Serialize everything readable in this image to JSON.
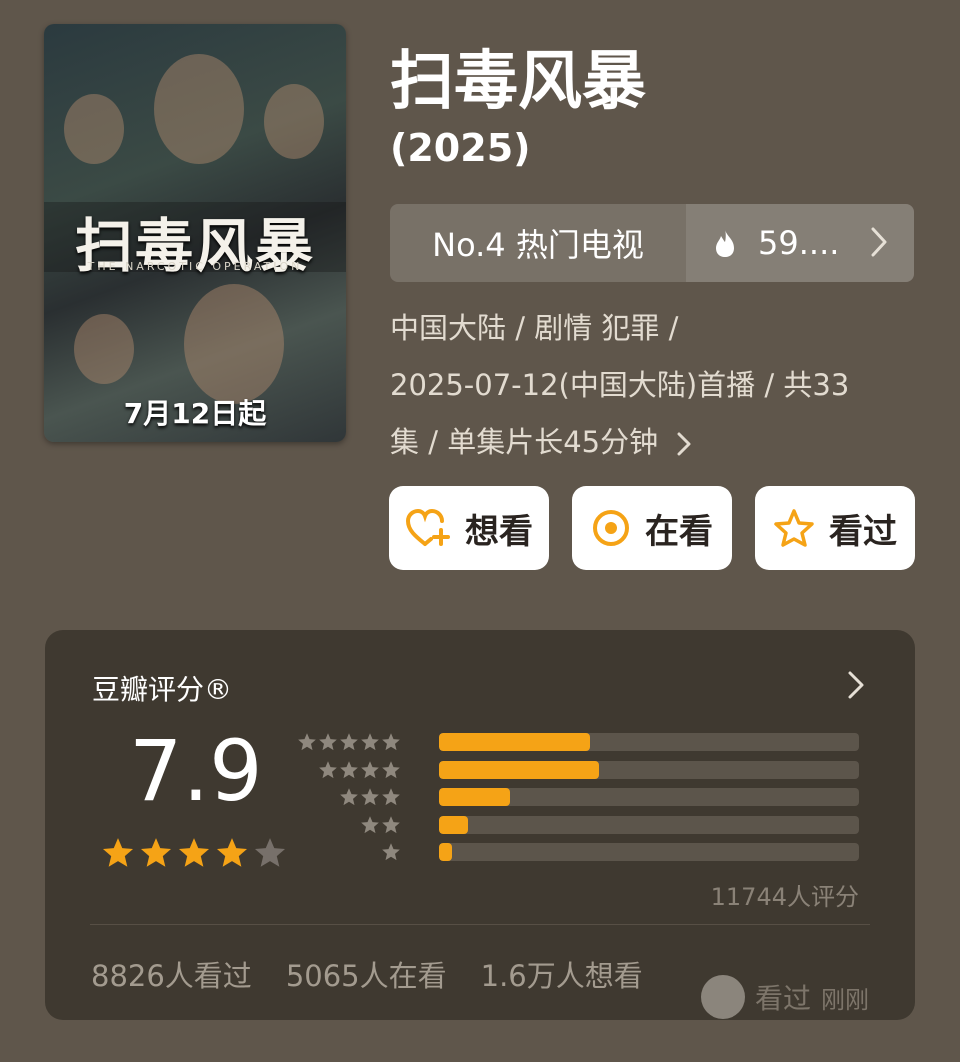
{
  "poster": {
    "title": "扫毒风暴",
    "subtitle": "THE NARCOTIC OPERATION",
    "date": "7月12日起"
  },
  "header": {
    "title": "扫毒风暴",
    "year": "(2025)"
  },
  "ranking": {
    "label": "No.4 热门电视",
    "heat": "59...."
  },
  "meta": {
    "line1": "中国大陆 / 剧情 犯罪 /",
    "line2": "2025-07-12(中国大陆)首播 / 共33",
    "line3": "集 / 单集片长45分钟"
  },
  "actions": {
    "want": "想看",
    "watching": "在看",
    "watched": "看过"
  },
  "rating": {
    "title": "豆瓣评分®",
    "score": "7.9",
    "star_level": 4,
    "distribution": [
      {
        "stars": 5,
        "fraction": 0.36
      },
      {
        "stars": 4,
        "fraction": 0.38
      },
      {
        "stars": 3,
        "fraction": 0.17
      },
      {
        "stars": 2,
        "fraction": 0.07
      },
      {
        "stars": 1,
        "fraction": 0.03
      }
    ],
    "count": "11744人评分",
    "watched": "8826人看过",
    "watching": "5065人在看",
    "want": "1.6万人想看"
  },
  "watermark": {
    "label": "看过",
    "time": "刚刚"
  },
  "colors": {
    "background": "#5f564b",
    "card": "#3f3930",
    "accent": "#f5a316"
  }
}
